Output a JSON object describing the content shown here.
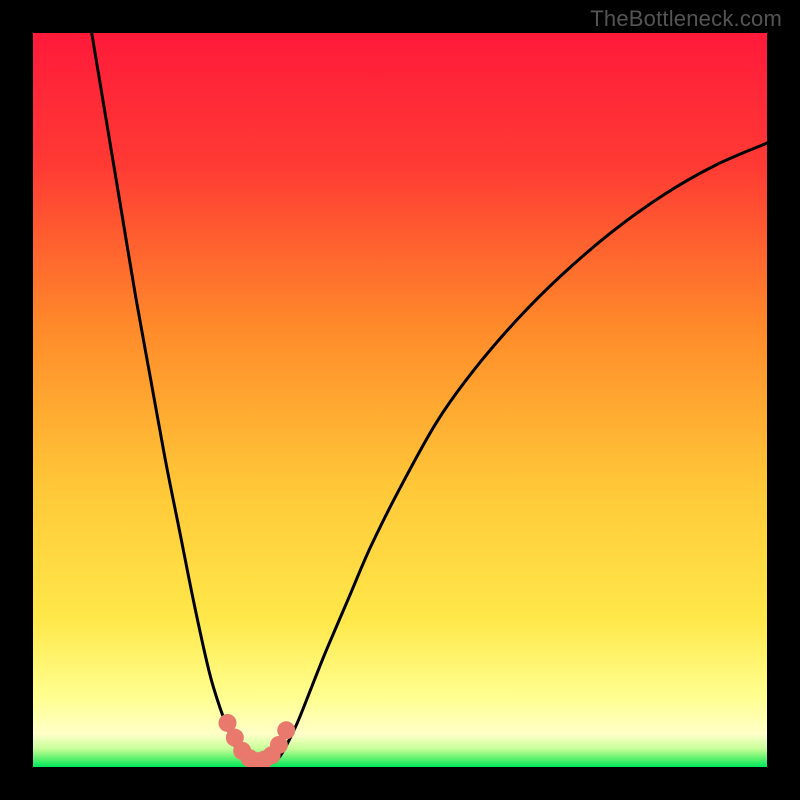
{
  "watermark": "TheBottleneck.com",
  "colors": {
    "frame": "#000000",
    "gradient_top": "#ff1a3a",
    "gradient_mid1": "#ff8a2a",
    "gradient_mid2": "#ffe84a",
    "gradient_mid3": "#ffff90",
    "gradient_bottom": "#00e85a",
    "curve": "#000000",
    "marker_fill": "#e9786d",
    "marker_stroke": "#c85a50"
  },
  "chart_data": {
    "type": "line",
    "title": "",
    "xlabel": "",
    "ylabel": "",
    "xlim": [
      0,
      100
    ],
    "ylim": [
      0,
      100
    ],
    "series": [
      {
        "name": "curve-left",
        "x": [
          8,
          10,
          12,
          14,
          16,
          18,
          20,
          22,
          24,
          25.5,
          27,
          28,
          29
        ],
        "y": [
          100,
          88,
          76,
          64,
          53,
          42,
          32,
          22,
          13,
          8,
          4,
          2,
          0.8
        ]
      },
      {
        "name": "curve-right",
        "x": [
          33,
          34,
          36,
          38,
          40,
          43,
          46,
          50,
          55,
          60,
          66,
          72,
          79,
          86,
          93,
          100
        ],
        "y": [
          0.8,
          2,
          6,
          11,
          16,
          23,
          30,
          38,
          47,
          54,
          61,
          67,
          73,
          78,
          82,
          85
        ]
      },
      {
        "name": "markers",
        "x": [
          26.5,
          27.5,
          28.5,
          29.5,
          30.5,
          31.5,
          32.5,
          33.5,
          34.5
        ],
        "y": [
          6,
          4,
          2.2,
          1.2,
          0.8,
          1.0,
          1.6,
          3.0,
          5.0
        ]
      }
    ],
    "green_band_y": [
      0,
      2.8
    ],
    "yellow_band_y": [
      2.8,
      9
    ]
  }
}
